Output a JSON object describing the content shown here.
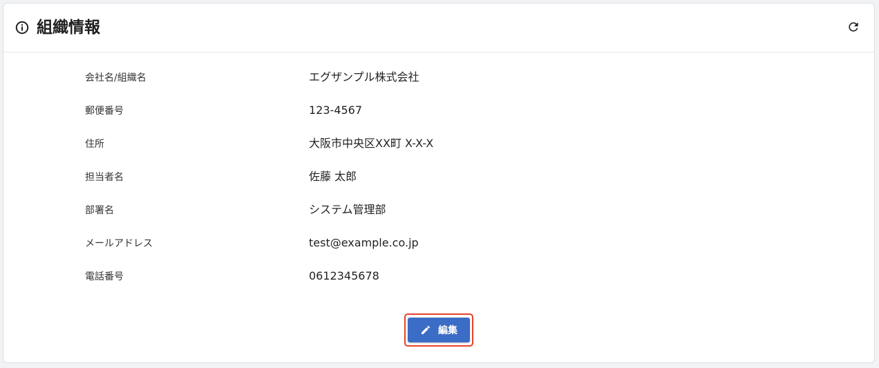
{
  "header": {
    "title": "組織情報",
    "info_icon": "info-circle-icon",
    "refresh_icon": "refresh-icon"
  },
  "fields": [
    {
      "label": "会社名/組織名",
      "value": "エグザンプル株式会社"
    },
    {
      "label": "郵便番号",
      "value": "123-4567"
    },
    {
      "label": "住所",
      "value": "大阪市中央区XX町 X-X-X"
    },
    {
      "label": "担当者名",
      "value": "佐藤 太郎"
    },
    {
      "label": "部署名",
      "value": "システム管理部"
    },
    {
      "label": "メールアドレス",
      "value": "test@example.co.jp"
    },
    {
      "label": "電話番号",
      "value": "0612345678"
    }
  ],
  "actions": {
    "edit_label": "編集",
    "edit_icon": "pencil-icon"
  },
  "colors": {
    "accent": "#3b6cc6",
    "highlight": "#e8402a"
  }
}
